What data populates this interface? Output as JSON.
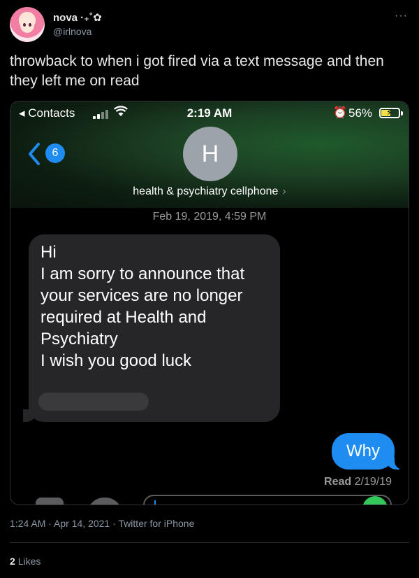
{
  "author": {
    "display_name": "nova ·₊˚✿",
    "handle": "@irlnova"
  },
  "tweet": {
    "text": "throwback to when i got fired via a text message and then they left me on read",
    "time": "1:24 AM",
    "date": "Apr 14, 2021",
    "source": "Twitter for iPhone",
    "likes_count": "2",
    "likes_label": "Likes"
  },
  "screenshot": {
    "status_bar": {
      "back_app": "Contacts",
      "time": "2:19 AM",
      "battery": "56%",
      "battery_level": 0.56
    },
    "thread": {
      "unread_count": "6",
      "contact_initial": "H",
      "contact_name": "health & psychiatry cellphone",
      "timestamp": "Feb 19, 2019, 4:59 PM",
      "incoming_message": "Hi\nI am sorry to announce that your services are no longer required at Health and Psychiatry\nI wish you good luck",
      "outgoing_message": "Why",
      "read_label": "Read",
      "read_date": "2/19/19"
    }
  },
  "colors": {
    "imessage_blue": "#1e8cf0",
    "incoming_gray": "#262629",
    "send_green": "#34c759"
  },
  "icons": [
    "more-icon",
    "back-chevron-icon",
    "signal-icon",
    "wifi-icon",
    "alarm-icon",
    "battery-icon",
    "camera-icon",
    "appstore-icon"
  ]
}
